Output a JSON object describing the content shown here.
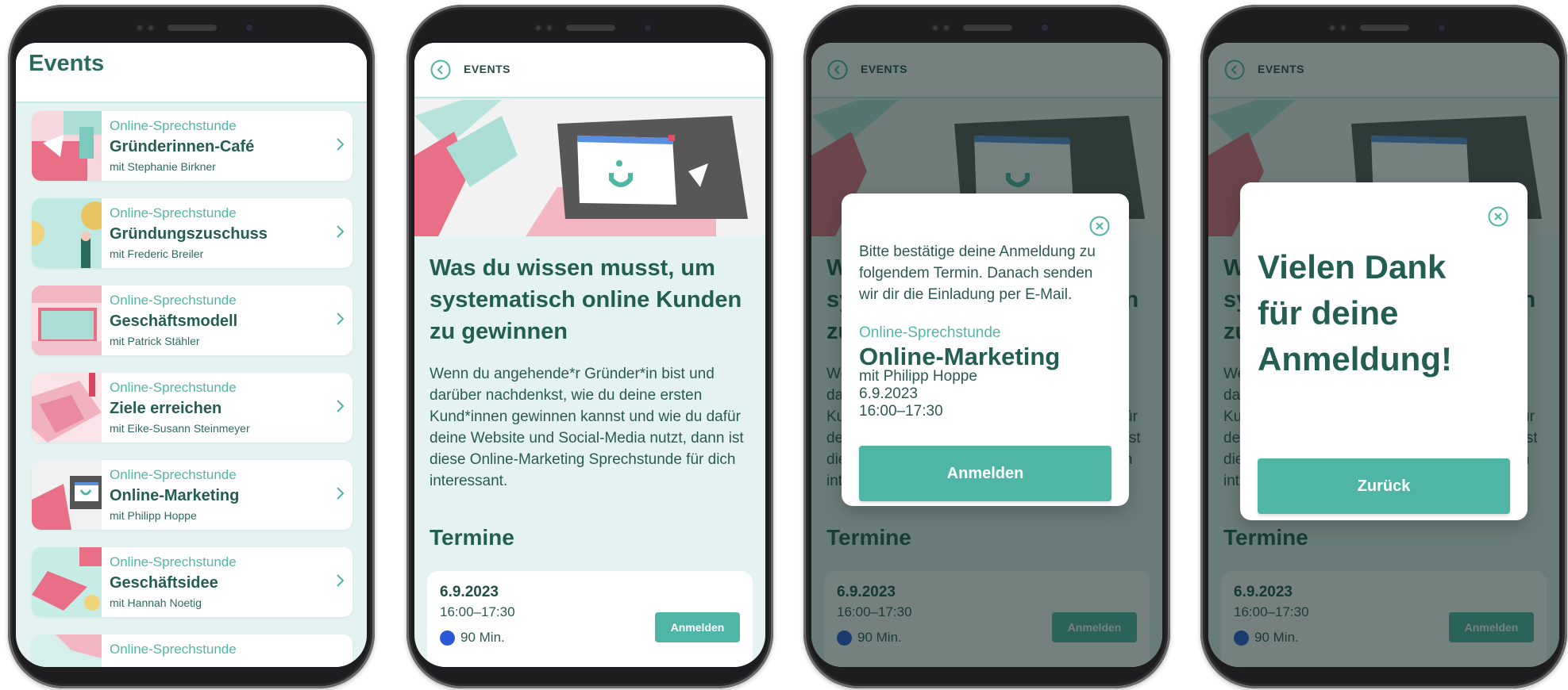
{
  "list": {
    "title": "Events",
    "items": [
      {
        "type": "Online-Sprechstunde",
        "title": "Gründerinnen-Café",
        "host": "mit Stephanie Birkner"
      },
      {
        "type": "Online-Sprechstunde",
        "title": "Gründungszuschuss",
        "host": "mit Frederic Breiler"
      },
      {
        "type": "Online-Sprechstunde",
        "title": "Geschäftsmodell",
        "host": "mit Patrick Stähler"
      },
      {
        "type": "Online-Sprechstunde",
        "title": "Ziele erreichen",
        "host": "mit Eike-Susann Steinmeyer"
      },
      {
        "type": "Online-Sprechstunde",
        "title": "Online-Marketing",
        "host": "mit Philipp Hoppe"
      },
      {
        "type": "Online-Sprechstunde",
        "title": "Geschäftsidee",
        "host": "mit Hannah Noetig"
      },
      {
        "type": "Online-Sprechstunde",
        "title": "",
        "host": ""
      }
    ]
  },
  "detail": {
    "back_label": "EVENTS",
    "title": "Was du wissen musst, um systematisch online Kunden zu gewinnen",
    "description": "Wenn du angehende*r Gründer*in bist und darüber nachdenkst, wie du deine ersten Kund*innen gewinnen kannst und wie du dafür deine Website und Social-Media nutzt, dann ist diese Online-Marketing Sprechstunde für dich interessant.",
    "section_title": "Termine",
    "slot": {
      "date": "6.9.2023",
      "time": "16:00–17:30",
      "duration": "90 Min.",
      "button": "Anmelden"
    }
  },
  "confirm_modal": {
    "text": "Bitte bestätige deine Anmeldung zu folgendem Termin. Danach senden wir dir die Einladung per E-Mail.",
    "type": "Online-Sprechstunde",
    "title": "Online-Marketing",
    "host": "mit Philipp Hoppe",
    "date": "6.9.2023",
    "time": "16:00–17:30",
    "button": "Anmelden"
  },
  "thanks_modal": {
    "message": "Vielen Dank für deine Anmeldung!",
    "button": "Zurück"
  },
  "colors": {
    "accent": "#4fb5a4",
    "heading": "#245e52",
    "background": "#e4f3f1",
    "video_icon": "#2b59d6"
  }
}
